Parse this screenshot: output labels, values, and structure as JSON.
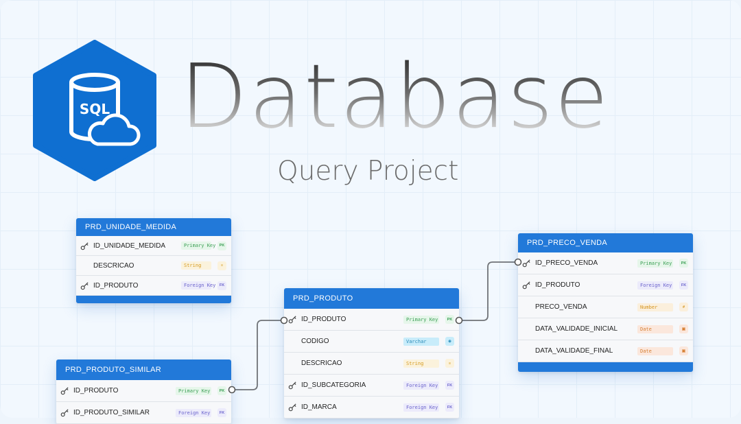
{
  "header": {
    "title": "Database",
    "subtitle": "Query Project"
  },
  "logo": {
    "text": "SQL",
    "icon": "database-cloud-icon",
    "color": "#0f6fd1"
  },
  "colors": {
    "table_header": "#2279d9",
    "connector": "#6f7276"
  },
  "tables": {
    "unidade": {
      "name": "PRD_UNIDADE_MEDIDA",
      "rows": [
        {
          "field": "ID_UNIDADE_MEDIDA",
          "type": "Primary Key",
          "badge": "PK"
        },
        {
          "field": "DESCRICAO",
          "type": "String",
          "badge": "≡"
        },
        {
          "field": "ID_PRODUTO",
          "type": "Foreign Key",
          "badge": "FK"
        }
      ]
    },
    "preco": {
      "name": "PRD_PRECO_VENDA",
      "rows": [
        {
          "field": "ID_PRECO_VENDA",
          "type": "Primary Key",
          "badge": "PK"
        },
        {
          "field": "ID_PRODUTO",
          "type": "Foreign Key",
          "badge": "FK"
        },
        {
          "field": "PRECO_VENDA",
          "type": "Number",
          "badge": "#"
        },
        {
          "field": "DATA_VALIDADE_INICIAL",
          "type": "Date",
          "badge": "▣"
        },
        {
          "field": "DATA_VALIDADE_FINAL",
          "type": "Date",
          "badge": "▣"
        }
      ]
    },
    "produto": {
      "name": "PRD_PRODUTO",
      "rows": [
        {
          "field": "ID_PRODUTO",
          "type": "Primary Key",
          "badge": "PK"
        },
        {
          "field": "CODIGO",
          "type": "Varchar",
          "badge": "⊕"
        },
        {
          "field": "DESCRICAO",
          "type": "String",
          "badge": "≡"
        },
        {
          "field": "ID_SUBCATEGORIA",
          "type": "Foreign Key",
          "badge": "FK"
        },
        {
          "field": "ID_MARCA",
          "type": "Foreign Key",
          "badge": "FK"
        }
      ]
    },
    "similar": {
      "name": "PRD_PRODUTO_SIMILAR",
      "rows": [
        {
          "field": "ID_PRODUTO",
          "type": "Primary Key",
          "badge": "PK"
        },
        {
          "field": "ID_PRODUTO_SIMILAR",
          "type": "Foreign Key",
          "badge": "FK"
        }
      ]
    }
  }
}
